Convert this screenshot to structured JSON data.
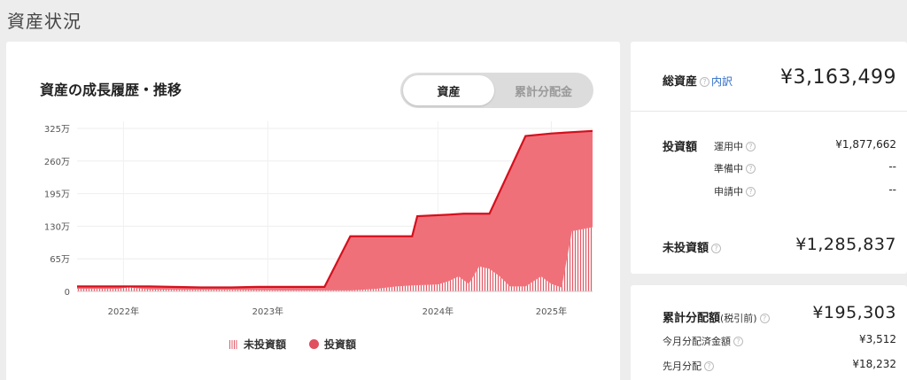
{
  "page": {
    "title": "資産状況"
  },
  "chart_card": {
    "title": "資産の成長履歴・推移",
    "toggle": {
      "active": "資産",
      "inactive": "累計分配金"
    },
    "legend": {
      "uninvested": "未投資額",
      "invested": "投資額"
    }
  },
  "colors": {
    "fill": "#f0707a",
    "line": "#d4101c",
    "stripe": "#e05a67"
  },
  "summary": {
    "total_label": "総資産",
    "breakdown_link": "内訳",
    "total_value": "¥3,163,499",
    "invest_label": "投資額",
    "operating_label": "運用中",
    "operating_value": "¥1,877,662",
    "preparing_label": "準備中",
    "preparing_value": "--",
    "applying_label": "申請中",
    "applying_value": "--",
    "uninvested_label": "未投資額",
    "uninvested_value": "¥1,285,837"
  },
  "distribution": {
    "label": "累計分配額",
    "label_note": "(税引前)",
    "value": "¥195,303",
    "this_month_label": "今月分配済金額",
    "this_month_value": "¥3,512",
    "last_month_label": "先月分配",
    "last_month_value": "¥18,232"
  },
  "chart_data": {
    "type": "area",
    "ylim": [
      0,
      325
    ],
    "y_ticks": [
      "0",
      "65万",
      "130万",
      "195万",
      "260万",
      "325万"
    ],
    "x_ticks": [
      "2022年",
      "2023年",
      "2024年",
      "2025年"
    ],
    "series": [
      {
        "name": "投資額",
        "x": [
          0,
          0.08,
          0.14,
          0.24,
          0.3,
          0.35,
          0.37,
          0.38,
          0.45,
          0.48,
          0.53,
          0.55,
          0.65,
          0.66,
          0.72,
          0.75,
          0.8,
          0.87,
          0.92,
          1.0
        ],
        "values": [
          10,
          10,
          10,
          8,
          8,
          9,
          9,
          9,
          9,
          9,
          110,
          110,
          110,
          150,
          153,
          155,
          155,
          310,
          315,
          320
        ]
      },
      {
        "name": "未投資額",
        "x": [
          0,
          0.08,
          0.1,
          0.12,
          0.14,
          0.2,
          0.3,
          0.4,
          0.48,
          0.5,
          0.53,
          0.55,
          0.58,
          0.62,
          0.65,
          0.68,
          0.7,
          0.72,
          0.74,
          0.76,
          0.78,
          0.8,
          0.82,
          0.84,
          0.87,
          0.9,
          0.92,
          0.94,
          0.96,
          1.0
        ],
        "values": [
          5,
          5,
          8,
          6,
          4,
          3,
          3,
          2,
          2,
          2,
          2,
          3,
          5,
          10,
          12,
          13,
          14,
          20,
          30,
          15,
          50,
          45,
          30,
          10,
          10,
          30,
          15,
          8,
          120,
          128
        ]
      }
    ]
  }
}
